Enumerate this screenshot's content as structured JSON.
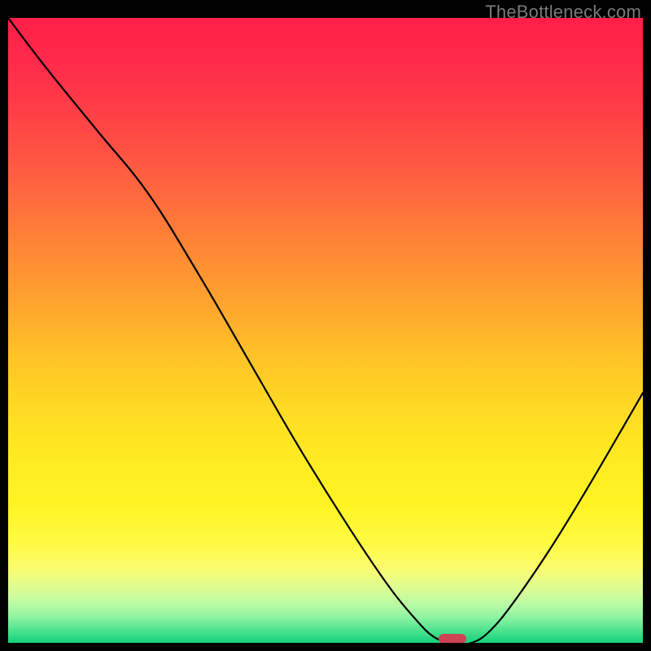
{
  "watermark": "TheBottleneck.com",
  "chart_data": {
    "type": "line",
    "title": "",
    "xlabel": "",
    "ylabel": "",
    "xlim": [
      0,
      100
    ],
    "ylim": [
      0,
      100
    ],
    "grid": false,
    "legend": false,
    "series": [
      {
        "name": "bottleneck-curve",
        "x": [
          0,
          6,
          14,
          22,
          30,
          38,
          46,
          54,
          60,
          64,
          67,
          70,
          73,
          76,
          80,
          86,
          92,
          100
        ],
        "values": [
          100,
          92,
          82,
          72,
          59,
          45,
          31,
          18,
          9,
          4,
          1,
          0,
          0,
          2,
          7,
          16,
          26,
          40
        ]
      }
    ],
    "optimum_marker": {
      "x": 70,
      "y": 0,
      "width_pct": 4.3,
      "height_pct": 1.3
    },
    "gradient_theme": "bottleneck-red-to-green"
  }
}
